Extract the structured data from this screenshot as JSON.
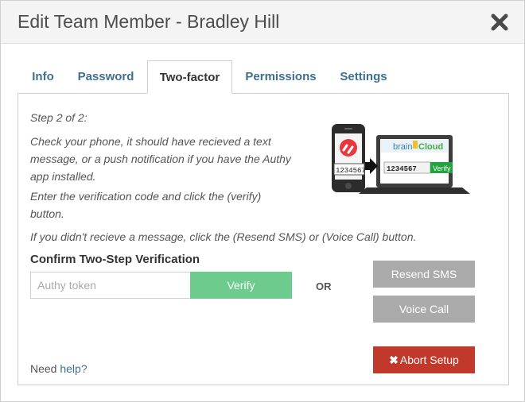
{
  "header": {
    "title": "Edit Team Member - Bradley Hill",
    "close_icon": "close-icon"
  },
  "tabs": [
    {
      "label": "Info",
      "active": false
    },
    {
      "label": "Password",
      "active": false
    },
    {
      "label": "Two-factor",
      "active": true
    },
    {
      "label": "Permissions",
      "active": false
    },
    {
      "label": "Settings",
      "active": false
    }
  ],
  "instructions": {
    "step": "Step 2 of 2:",
    "check_line1": "Check your phone, it should have recieved a text",
    "check_line2": "message, or a push notification if you have the Authy",
    "check_line3": "app installed.",
    "enter_line1": "Enter the verification code and click the (verify)",
    "enter_line2": "button.",
    "resend_hint": "If you didn't recieve a message, click the (Resend SMS) or (Voice Call) button."
  },
  "illustration": {
    "phone_code": "1234567",
    "laptop_brand_left": "brain",
    "laptop_brand_right": "Cloud",
    "laptop_code": "1234567",
    "laptop_verify": "Verify"
  },
  "confirm": {
    "title": "Confirm Two-Step Verification",
    "token_placeholder": "Authy token",
    "token_value": "",
    "verify_label": "Verify",
    "or_label": "OR",
    "resend_label": "Resend SMS",
    "voice_label": "Voice Call",
    "abort_label": "Abort Setup"
  },
  "help": {
    "prefix": "Need",
    "link": "help?"
  },
  "colors": {
    "verify": "#6dcb8e",
    "abort": "#c0392b",
    "secondary": "#aaaaaa",
    "link": "#3f6f8f",
    "authy_red": "#e8373d",
    "laptop_verify": "#22a33d"
  }
}
